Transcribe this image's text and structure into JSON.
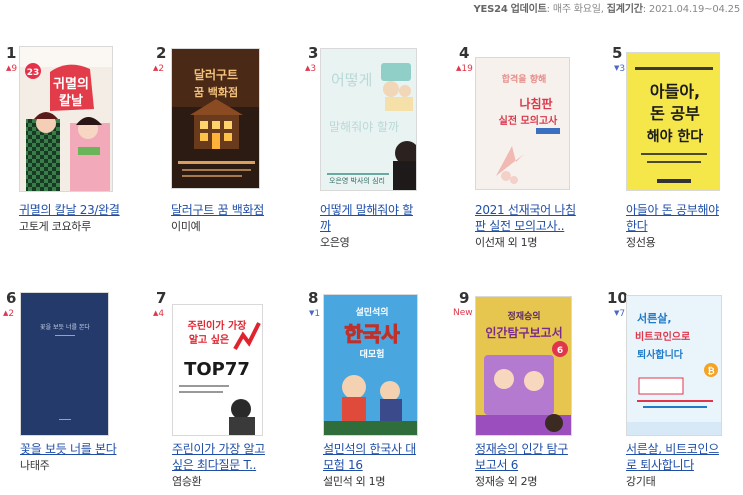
{
  "header": {
    "source": "YES24",
    "update_label": "업데이트",
    "update_value": "매주 화요일",
    "period_label": "집계기간",
    "period_value": "2021.04.19~04.25"
  },
  "books": [
    {
      "rank": "1",
      "change": "9",
      "dir": "up",
      "title_lines": [
        "귀멸의 칼날 23/완결"
      ],
      "author": "고토게 코요하루",
      "cover": {
        "bg": "#f3ede6",
        "main_text": "귀멸의",
        "sub_text": "칼날",
        "badge": "23"
      }
    },
    {
      "rank": "2",
      "change": "2",
      "dir": "up",
      "title_lines": [
        "달러구트 꿈 백화점"
      ],
      "author": "이미예",
      "cover": {
        "bg": "#2a1a10",
        "main_text": "달러구트",
        "sub_text": "꿈 백화점"
      }
    },
    {
      "rank": "3",
      "change": "3",
      "dir": "up",
      "title_lines": [
        "어떻게 말해줘야 할",
        "까"
      ],
      "author": "오은영",
      "cover": {
        "bg": "#eaf3f1",
        "main_text": "어떻게",
        "sub_text": "말해줘야 할까",
        "caption": "오은영 박사의 심리"
      }
    },
    {
      "rank": "4",
      "change": "19",
      "dir": "up",
      "title_lines": [
        "2021 선재국어 나침",
        "판 실전 모의고사.."
      ],
      "author": "이선재 외 1명",
      "cover": {
        "bg": "#f6f1ee",
        "main_text": "합격을 향해",
        "sub_text": "나침판",
        "caption": "실전 모의고사"
      }
    },
    {
      "rank": "5",
      "change": "3",
      "dir": "down",
      "title_lines": [
        "아들아 돈 공부해야",
        "한다"
      ],
      "author": "정선용",
      "cover": {
        "bg": "#f4e44a",
        "main_text": "아들아,",
        "sub_text": "돈 공부",
        "caption": "해야 한다"
      }
    },
    {
      "rank": "6",
      "change": "2",
      "dir": "up",
      "title_lines": [
        "꽃을 보듯 너를 본다"
      ],
      "author": "나태주",
      "cover": {
        "bg": "#2a3c6a",
        "main_text": "꽃을 보듯 너를 본다"
      }
    },
    {
      "rank": "7",
      "change": "4",
      "dir": "up",
      "title_lines": [
        "주린이가 가장 알고",
        "싶은 최다질문 T.."
      ],
      "author": "염승환",
      "cover": {
        "bg": "#ffffff",
        "main_text": "주린이가 가장",
        "sub_text": "알고 싶은",
        "caption": "TOP77"
      }
    },
    {
      "rank": "8",
      "change": "1",
      "dir": "down",
      "title_lines": [
        "설민석의 한국사 대",
        "모험 16"
      ],
      "author": "설민석 외 1명",
      "cover": {
        "bg": "#49a6de",
        "main_text": "설민석의",
        "sub_text": "한국사",
        "caption": "대모험"
      }
    },
    {
      "rank": "9",
      "change": "New",
      "dir": "new",
      "title_lines": [
        "정재승의 인간 탐구",
        "보고서 6"
      ],
      "author": "정재승 외 2명",
      "cover": {
        "bg": "#e8c74f",
        "main_text": "정재승의",
        "sub_text": "인간탐구보고서",
        "badge": "6"
      }
    },
    {
      "rank": "10",
      "change": "7",
      "dir": "down",
      "title_lines": [
        "서른살, 비트코인으",
        "로 퇴사합니다"
      ],
      "author": "강기태",
      "cover": {
        "bg": "#eaf3fa",
        "main_text": "서른살,",
        "sub_text": "비트코인으로",
        "caption": "퇴사합니다"
      }
    }
  ],
  "colors": {
    "link": "#1f4ea8",
    "up": "#e0364b",
    "down": "#4a68c7"
  }
}
